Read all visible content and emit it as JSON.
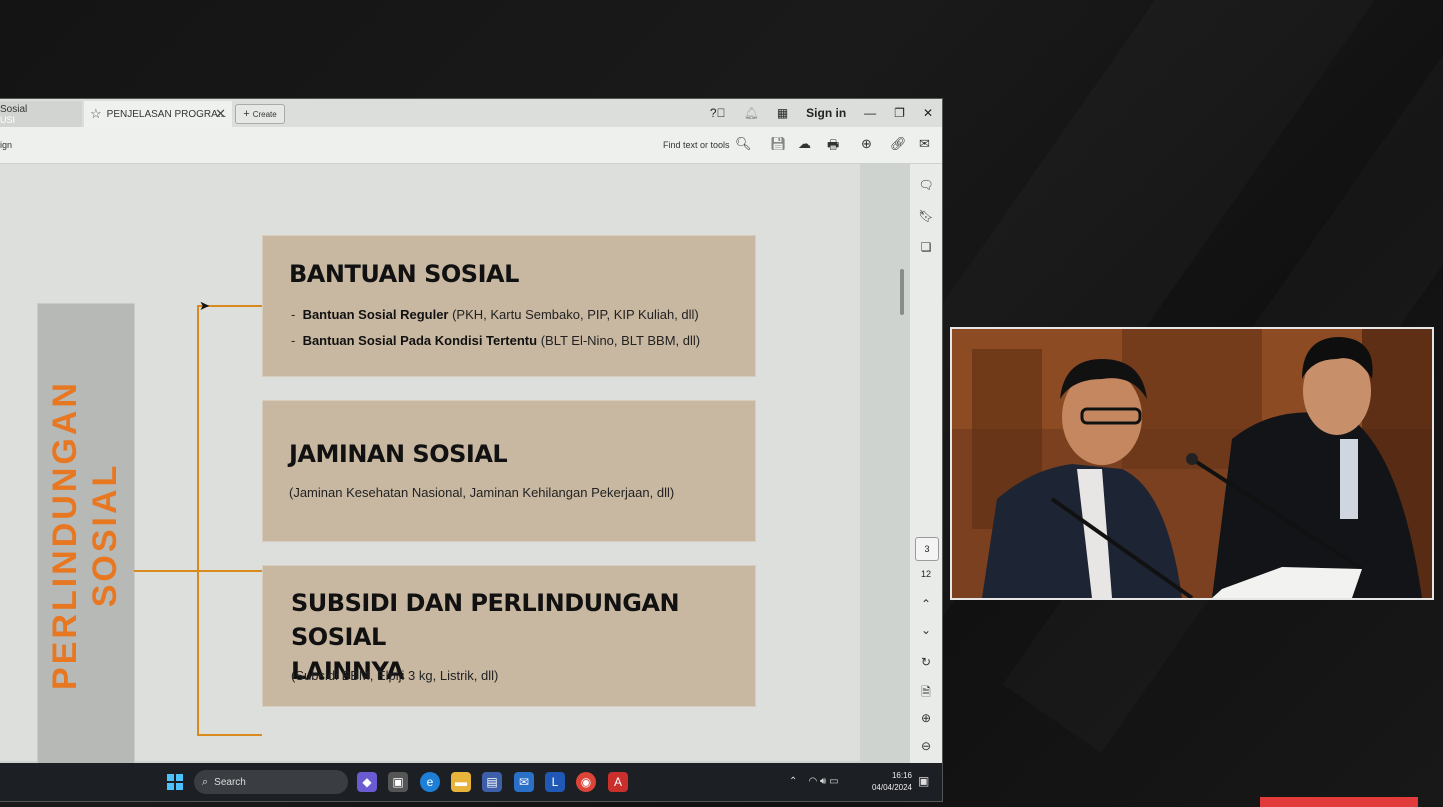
{
  "window": {
    "tab_prev_label": "Sosial",
    "tab_prev_sub": "USI",
    "tab_active_label": "PENJELASAN PROGRA...",
    "new_tab_label": "Create",
    "sign_in": "Sign in",
    "toolbar_left": "ign",
    "find_placeholder": "Find text or tools"
  },
  "slide": {
    "vertical_title_line1": "PERLINDUNGAN",
    "vertical_title_line2": "SOSIAL",
    "boxes": [
      {
        "title": "BANTUAN SOSIAL",
        "items": [
          {
            "bold": "Bantuan Sosial Reguler",
            "rest": " (PKH, Kartu Sembako, PIP, KIP Kuliah, dll)"
          },
          {
            "bold": "Bantuan Sosial Pada Kondisi Tertentu",
            "rest": " (BLT El-Nino, BLT BBM,  dll)"
          }
        ]
      },
      {
        "title": "JAMINAN SOSIAL",
        "desc": "(Jaminan Kesehatan Nasional, Jaminan Kehilangan Pekerjaan, dll)"
      },
      {
        "title_line1": "SUBSIDI DAN PERLINDUNGAN SOSIAL",
        "title_line2": "LAINNYA",
        "desc": "(Subsidi BBM, Elpiji 3 kg, Listrik, dll)"
      }
    ],
    "page_number": "3",
    "colors": {
      "accent": "#e87722",
      "box": "#c9b8a1",
      "footer_bar": "#f0a020"
    }
  },
  "viewer": {
    "current_page": "3",
    "total_pages": "12"
  },
  "taskbar": {
    "search_placeholder": "Search",
    "time": "16:16",
    "date": "04/04/2024"
  }
}
